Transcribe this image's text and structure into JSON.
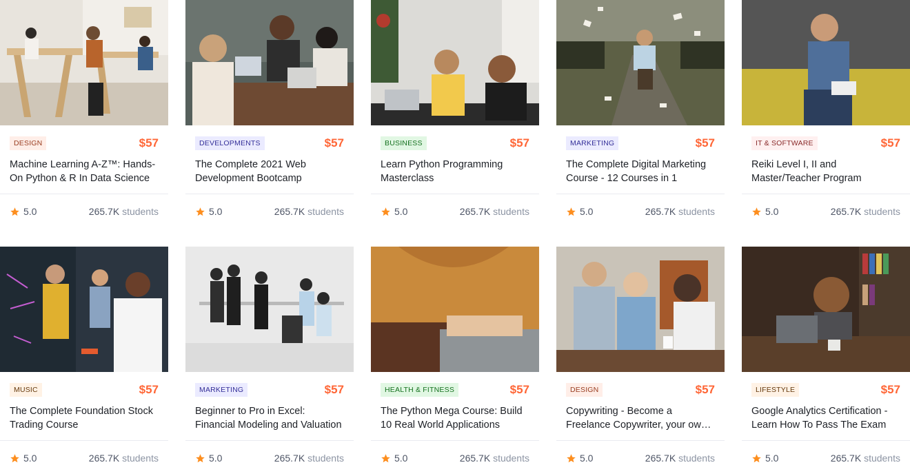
{
  "colors": {
    "price": "#ff6636",
    "star": "#fd8e1f"
  },
  "courses": [
    {
      "category": "Design",
      "badge_bg": "#ffeee8",
      "badge_fg": "#993d20",
      "price": "$57",
      "title": "Machine Learning A-Z™: Hands-On Python & R In Data Science",
      "rating": "5.0",
      "students_num": "265.7K",
      "students_label": "students"
    },
    {
      "category": "Developments",
      "badge_bg": "#ebebff",
      "badge_fg": "#342f98",
      "price": "$57",
      "title": "The Complete 2021 Web Development Bootcamp",
      "rating": "5.0",
      "students_num": "265.7K",
      "students_label": "students"
    },
    {
      "category": "Business",
      "badge_bg": "#e1f7e3",
      "badge_fg": "#15711f",
      "price": "$57",
      "title": "Learn Python Programming Masterclass",
      "rating": "5.0",
      "students_num": "265.7K",
      "students_label": "students"
    },
    {
      "category": "Marketing",
      "badge_bg": "#ebebff",
      "badge_fg": "#342f98",
      "price": "$57",
      "title": "The Complete Digital Marketing Course - 12 Courses in 1",
      "rating": "5.0",
      "students_num": "265.7K",
      "students_label": "students"
    },
    {
      "category": "IT & Software",
      "badge_bg": "#fff0f0",
      "badge_fg": "#882929",
      "price": "$57",
      "title": "Reiki Level I, II and Master/Teacher Program",
      "rating": "5.0",
      "students_num": "265.7K",
      "students_label": "students"
    },
    {
      "category": "Music",
      "badge_bg": "#fff2e5",
      "badge_fg": "#65390c",
      "price": "$57",
      "title": "The Complete Foundation Stock Trading Course",
      "rating": "5.0",
      "students_num": "265.7K",
      "students_label": "students"
    },
    {
      "category": "Marketing",
      "badge_bg": "#ebebff",
      "badge_fg": "#342f98",
      "price": "$57",
      "title": "Beginner to Pro in Excel: Financial Modeling and Valuation",
      "rating": "5.0",
      "students_num": "265.7K",
      "students_label": "students"
    },
    {
      "category": "Health & Fitness",
      "badge_bg": "#e1f7e3",
      "badge_fg": "#15711f",
      "price": "$57",
      "title": "The Python Mega Course: Build 10 Real World Applications",
      "rating": "5.0",
      "students_num": "265.7K",
      "students_label": "students"
    },
    {
      "category": "Design",
      "badge_bg": "#ffeee8",
      "badge_fg": "#993d20",
      "price": "$57",
      "title": "Copywriting - Become a Freelance Copywriter, your own boss",
      "rating": "5.0",
      "students_num": "265.7K",
      "students_label": "students"
    },
    {
      "category": "Lifestyle",
      "badge_bg": "#fff2e5",
      "badge_fg": "#65390c",
      "price": "$57",
      "title": "Google Analytics Certification - Learn How To Pass The Exam",
      "rating": "5.0",
      "students_num": "265.7K",
      "students_label": "students"
    }
  ]
}
